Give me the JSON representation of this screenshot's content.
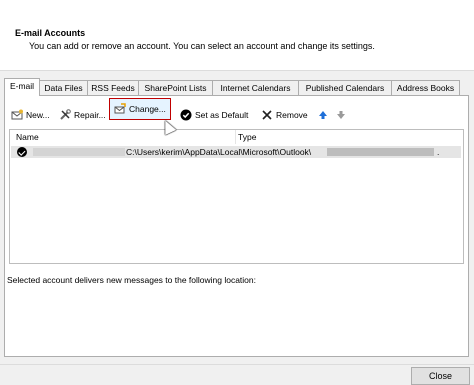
{
  "dialog": {
    "title": "E-mail Accounts",
    "subtitle": "You can add or remove an account. You can select an account and change its settings."
  },
  "tabs": [
    {
      "label": "E-mail",
      "active": true
    },
    {
      "label": "Data Files"
    },
    {
      "label": "RSS Feeds"
    },
    {
      "label": "SharePoint Lists"
    },
    {
      "label": "Internet Calendars"
    },
    {
      "label": "Published Calendars"
    },
    {
      "label": "Address Books"
    }
  ],
  "toolbar": {
    "new_label": "New...",
    "repair_label": "Repair...",
    "change_label": "Change...",
    "set_default_label": "Set as Default",
    "remove_label": "Remove"
  },
  "list": {
    "columns": [
      "Name",
      "Type"
    ],
    "rows": [
      {
        "type": "C:\\Users\\kerim\\AppData\\Local\\Microsoft\\Outlook\\",
        "suffix": ".",
        "default": true
      }
    ]
  },
  "delivery_text": "Selected account delivers new messages to the following location:",
  "buttons": {
    "close": "Close"
  },
  "colors": {
    "highlight_border": "#c00000",
    "accent": "#1e6fd8"
  }
}
